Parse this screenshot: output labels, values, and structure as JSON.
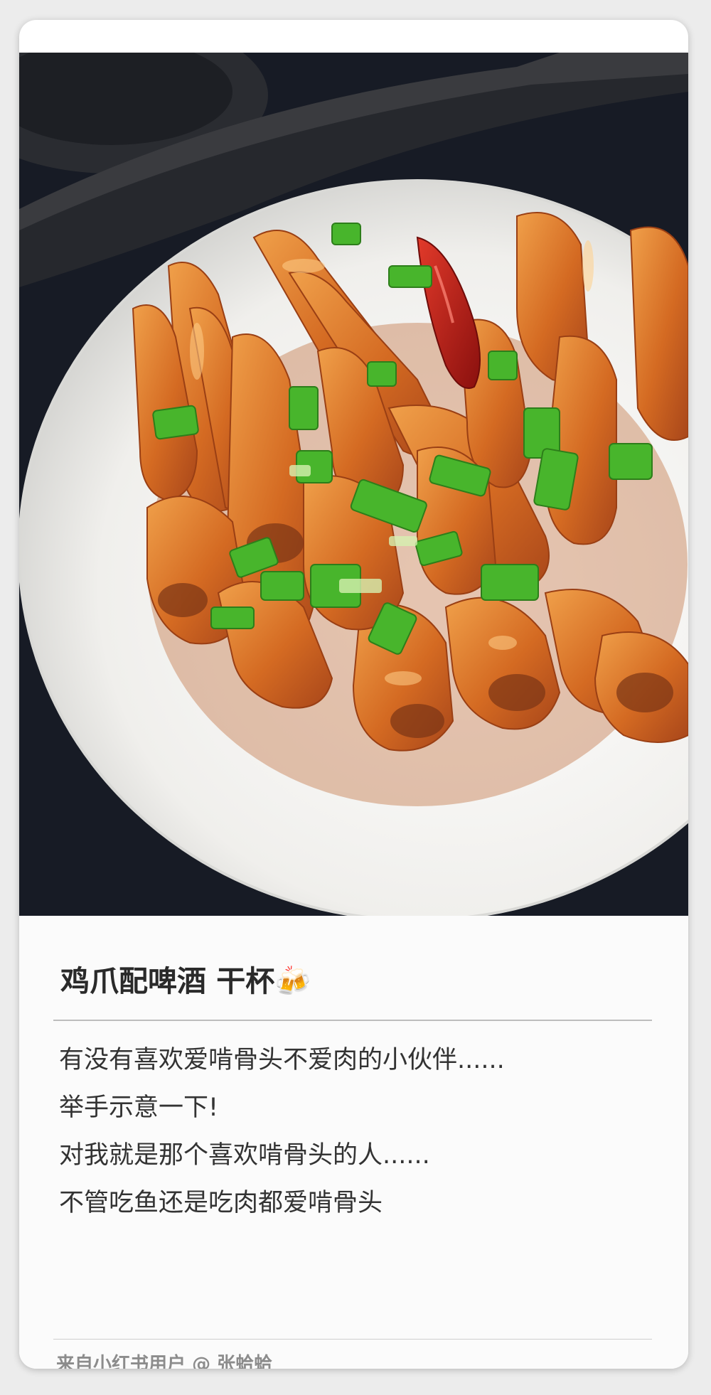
{
  "post": {
    "title": "鸡爪配啤酒 干杯🍻",
    "body_lines": [
      "有没有喜欢爱啃骨头不爱肉的小伙伴......",
      "举手示意一下!",
      "对我就是那个喜欢啃骨头的人......",
      "不管吃鱼还是吃肉都爱啃骨头"
    ]
  },
  "footer": {
    "source": "来自小红书用户",
    "author": "@ 张蛤蛤"
  },
  "colors": {
    "sauce": "#c8601e",
    "scallion": "#3fae2a",
    "chili": "#c0201a",
    "plate": "#f3f3f1",
    "table": "#121620"
  }
}
